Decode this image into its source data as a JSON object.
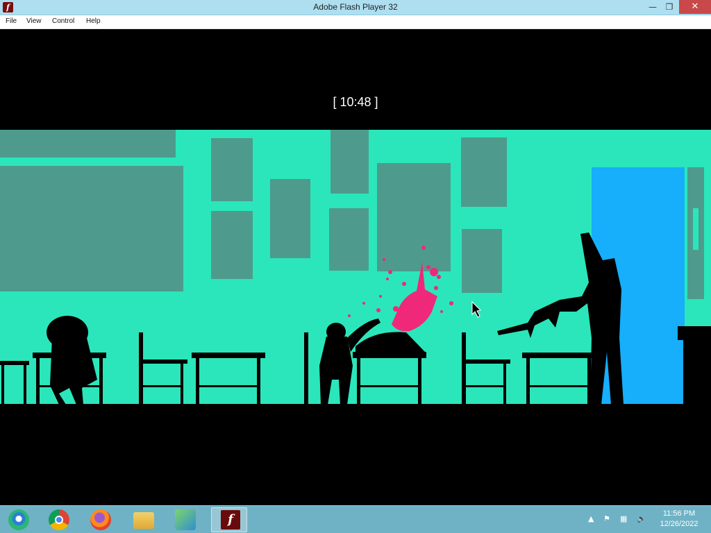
{
  "window": {
    "title": "Adobe Flash Player 32",
    "icon": "flash-player-icon",
    "minimize_glyph": "—",
    "maximize_glyph": "❐",
    "close_glyph": "✕"
  },
  "menu": {
    "items": [
      "File",
      "View",
      "Control",
      "Help"
    ]
  },
  "game": {
    "clock_text": "[ 10:48 ]",
    "colors": {
      "wall": "#2be6bb",
      "panel": "#4e9b8d",
      "door": "#17aefb",
      "blood": "#f0287a",
      "silhouette": "#000000"
    }
  },
  "taskbar": {
    "apps": [
      {
        "icon": "media-center-icon"
      },
      {
        "icon": "chrome-icon"
      },
      {
        "icon": "firefox-icon"
      },
      {
        "icon": "file-explorer-icon"
      },
      {
        "icon": "network-users-icon"
      },
      {
        "icon": "flash-player-icon"
      }
    ],
    "tray": {
      "icons": [
        "show-hidden-icons-icon",
        "action-center-flag-icon",
        "network-icon",
        "volume-icon"
      ],
      "time": "11:56 PM",
      "date": "12/26/2022"
    }
  }
}
